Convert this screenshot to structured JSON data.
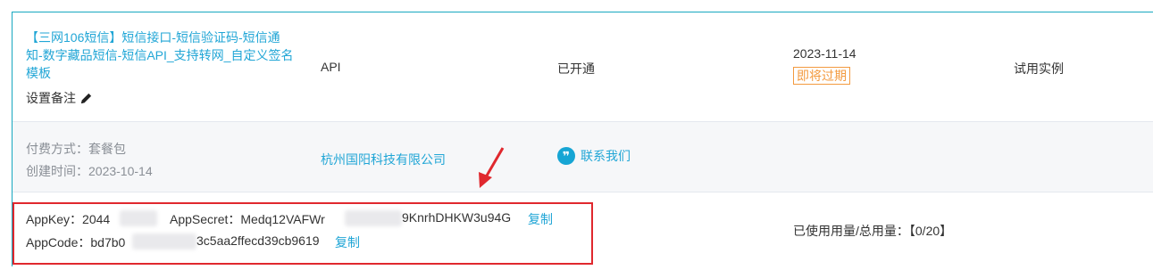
{
  "product": {
    "name": "【三网106短信】短信接口-短信验证码-短信通知-数字藏品短信-短信API_支持转网_自定义签名模板",
    "remark_label": "设置备注",
    "type": "API",
    "status": "已开通",
    "expire_date": "2023-11-14",
    "expire_badge": "即将过期",
    "instance_note": "试用实例"
  },
  "details": {
    "pay_method": "付费方式：套餐包",
    "created_time": "创建时间：2023-10-14",
    "company": "杭州国阳科技有限公司",
    "contact": "联系我们"
  },
  "credentials": {
    "appkey_label": "AppKey：2044",
    "appsecret_label": "AppSecret：Medq12VAFWr",
    "appsecret_suffix": "9KnrhDHKW3u94G",
    "copy_label": "复制",
    "appcode_label": "AppCode：bd7b0",
    "appcode_suffix": "3c5aa2ffecd39cb9619",
    "usage": "已使用用量/总用量：【0/20】"
  },
  "colors": {
    "accent": "#21a6d6",
    "warning": "#f39a3f",
    "highlight": "#e0282e",
    "frame": "#17a8c0"
  },
  "icons": [
    "pencil-icon",
    "chat-bubble-icon",
    "red-arrow-annotation"
  ]
}
